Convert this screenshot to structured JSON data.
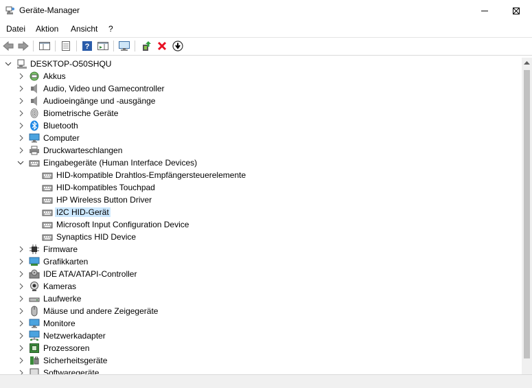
{
  "window": {
    "title": "Geräte-Manager"
  },
  "menu": {
    "items": [
      "Datei",
      "Aktion",
      "Ansicht",
      "?"
    ]
  },
  "toolbar": {
    "buttons": [
      "back-icon",
      "forward-icon",
      "show-hide-console-tree-icon",
      "properties-icon",
      "help-icon",
      "action-pane-icon",
      "scan-hardware-icon",
      "update-driver-icon",
      "uninstall-device-icon",
      "disable-device-icon"
    ]
  },
  "tree": {
    "root": "DESKTOP-O50SHQU",
    "items": [
      {
        "label": "Akkus",
        "icon": "battery-icon",
        "level": 1,
        "expanded": false
      },
      {
        "label": "Audio, Video und Gamecontroller",
        "icon": "speaker-icon",
        "level": 1,
        "expanded": false
      },
      {
        "label": "Audioeingänge und -ausgänge",
        "icon": "speaker-icon",
        "level": 1,
        "expanded": false
      },
      {
        "label": "Biometrische Geräte",
        "icon": "fingerprint-icon",
        "level": 1,
        "expanded": false
      },
      {
        "label": "Bluetooth",
        "icon": "bluetooth-icon",
        "level": 1,
        "expanded": false
      },
      {
        "label": "Computer",
        "icon": "monitor-icon",
        "level": 1,
        "expanded": false
      },
      {
        "label": "Druckwarteschlangen",
        "icon": "printer-icon",
        "level": 1,
        "expanded": false
      },
      {
        "label": "Eingabegeräte (Human Interface Devices)",
        "icon": "hid-icon",
        "level": 1,
        "expanded": true
      },
      {
        "label": "HID-kompatible Drahtlos-Empfängersteuerelemente",
        "icon": "hid-icon",
        "level": 2
      },
      {
        "label": "HID-kompatibles Touchpad",
        "icon": "hid-icon",
        "level": 2
      },
      {
        "label": "HP Wireless Button Driver",
        "icon": "hid-icon",
        "level": 2
      },
      {
        "label": "I2C HID-Gerät",
        "icon": "hid-icon",
        "level": 2,
        "selected": true
      },
      {
        "label": "Microsoft Input Configuration Device",
        "icon": "hid-icon",
        "level": 2
      },
      {
        "label": "Synaptics HID Device",
        "icon": "hid-icon",
        "level": 2
      },
      {
        "label": "Firmware",
        "icon": "chip-icon",
        "level": 1,
        "expanded": false
      },
      {
        "label": "Grafikkarten",
        "icon": "display-adapter-icon",
        "level": 1,
        "expanded": false
      },
      {
        "label": "IDE ATA/ATAPI-Controller",
        "icon": "disk-controller-icon",
        "level": 1,
        "expanded": false
      },
      {
        "label": "Kameras",
        "icon": "camera-icon",
        "level": 1,
        "expanded": false
      },
      {
        "label": "Laufwerke",
        "icon": "drive-icon",
        "level": 1,
        "expanded": false
      },
      {
        "label": "Mäuse und andere Zeigegeräte",
        "icon": "mouse-icon",
        "level": 1,
        "expanded": false
      },
      {
        "label": "Monitore",
        "icon": "monitor-icon",
        "level": 1,
        "expanded": false
      },
      {
        "label": "Netzwerkadapter",
        "icon": "network-icon",
        "level": 1,
        "expanded": false
      },
      {
        "label": "Prozessoren",
        "icon": "processor-icon",
        "level": 1,
        "expanded": false
      },
      {
        "label": "Sicherheitsgeräte",
        "icon": "security-icon",
        "level": 1,
        "expanded": false
      },
      {
        "label": "Softwaregeräte",
        "icon": "software-device-icon",
        "level": 1,
        "expanded": false
      }
    ]
  },
  "colors": {
    "selection": "#cce8ff",
    "accent": "#0078d7",
    "uninstall": "#e81123"
  }
}
